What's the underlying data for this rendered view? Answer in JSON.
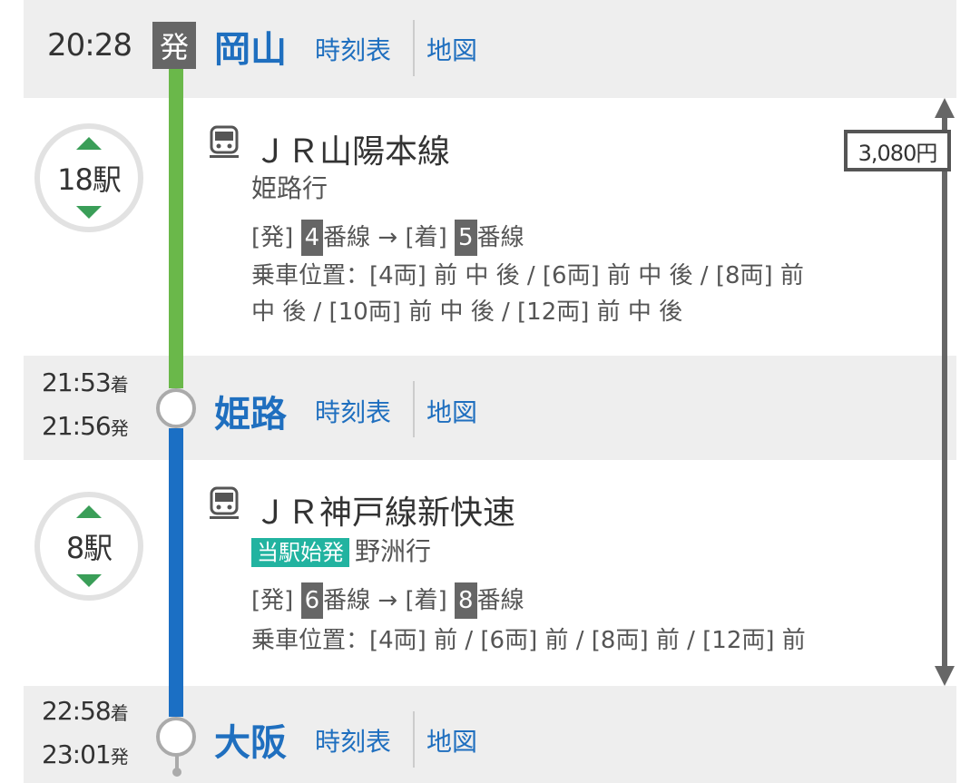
{
  "colors": {
    "green_line": "#6ab84a",
    "blue_line": "#1b6fc4",
    "station_blue": "#1f6fbf",
    "band_gray": "#eeeeee",
    "arrow_green": "#3a9e58",
    "start_tag": "#22b3a0"
  },
  "fare": "3,080円",
  "stations": [
    {
      "name": "岡山",
      "time": "20:28",
      "badge": "発",
      "timetable": "時刻表",
      "map": "地図"
    },
    {
      "name": "姫路",
      "arr": "21:53",
      "arr_suffix": "着",
      "dep": "21:56",
      "dep_suffix": "発",
      "timetable": "時刻表",
      "map": "地図"
    },
    {
      "name": "大阪",
      "arr": "22:58",
      "arr_suffix": "着",
      "dep": "23:01",
      "dep_suffix": "発",
      "timetable": "時刻表",
      "map": "地図"
    }
  ],
  "segments": [
    {
      "stops": "18駅",
      "train": "ＪＲ山陽本線",
      "dest": "姫路行",
      "dep_label": "[発]",
      "dep_track": "4",
      "track_word": "番線",
      "arrow": "→",
      "arr_label": "[着]",
      "arr_track": "5",
      "position_line1": "乗車位置：[4両] 前 中 後 / [6両] 前 中 後 / [8両] 前",
      "position_line2": "中 後 / [10両] 前 中 後 / [12両] 前 中 後"
    },
    {
      "stops": "8駅",
      "train": "ＪＲ神戸線新快速",
      "tag": "当駅始発",
      "dest": "野洲行",
      "dep_label": "[発]",
      "dep_track": "6",
      "track_word": "番線",
      "arrow": "→",
      "arr_label": "[着]",
      "arr_track": "8",
      "position_line1": "乗車位置：[4両] 前 / [6両] 前 / [8両] 前 / [12両] 前"
    }
  ],
  "icons": {
    "train": "train-icon",
    "up": "triangle-up-icon",
    "down": "triangle-down-icon"
  }
}
